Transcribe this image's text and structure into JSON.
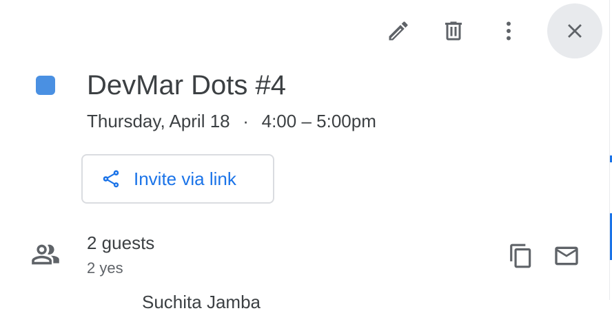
{
  "toolbar": {
    "edit_icon": "pencil-icon",
    "delete_icon": "trash-icon",
    "more_icon": "more-vert-icon",
    "close_icon": "close-icon"
  },
  "event": {
    "color": "#4a90e2",
    "title": "DevMar Dots #4",
    "date": "Thursday, April 18",
    "separator": "·",
    "time": "4:00 – 5:00pm"
  },
  "invite": {
    "label": "Invite via link",
    "icon": "share-icon",
    "accent": "#1a73e8"
  },
  "guests": {
    "count_label": "2 guests",
    "rsvp_label": "2 yes",
    "icon": "people-icon",
    "copy_icon": "copy-icon",
    "email_icon": "email-icon"
  },
  "cutoff_text": "Suchita Jamba"
}
